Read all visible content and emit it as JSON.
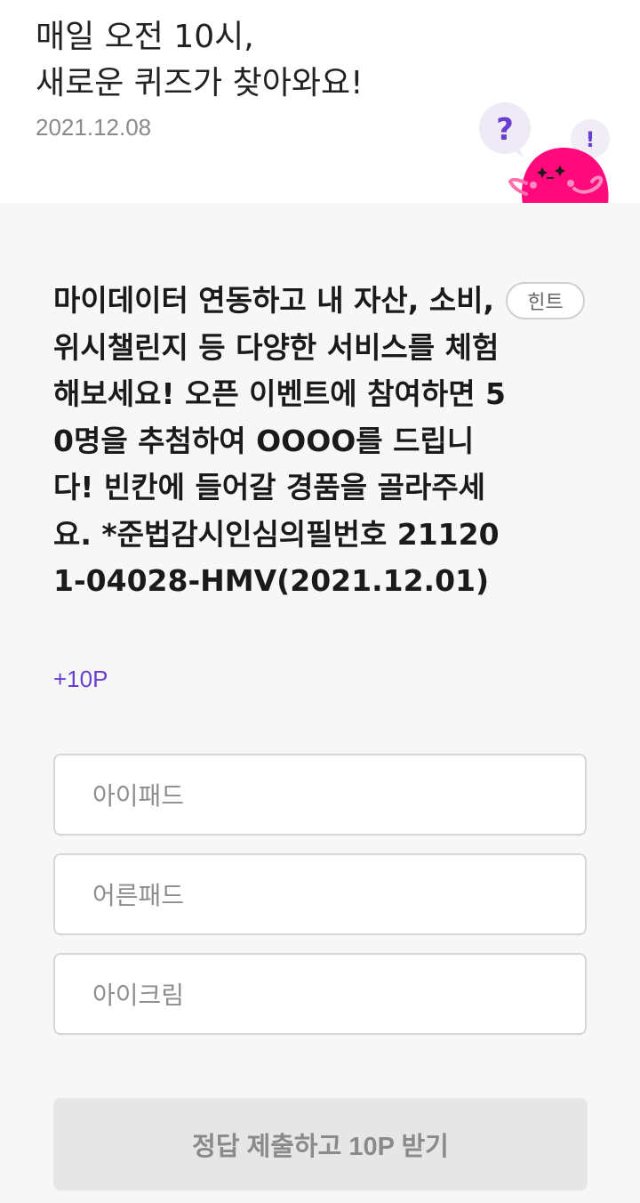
{
  "header": {
    "title": "매일 오전 10시,\n새로운 퀴즈가 찾아와요!",
    "date": "2021.12.08"
  },
  "mascot": {
    "bubble_left": "?",
    "bubble_right": "!",
    "accent_purple": "#6a3fd0",
    "body_color": "#ff0a7c"
  },
  "quiz": {
    "question": "마이데이터 연동하고 내 자산, 소비, 위시챌린지 등 다양한 서비스를 체험해보세요! 오픈 이벤트에 참여하면 50명을 추첨하여 OOOO를 드립니다! 빈칸에 들어갈 경품을 골라주세요. *준법감시인심의필번호 211201-04028-HMV(2021.12.01)",
    "hint_label": "힌트",
    "reward": "+10P",
    "options": [
      {
        "label": "아이패드"
      },
      {
        "label": "어른패드"
      },
      {
        "label": "아이크림"
      }
    ],
    "submit_label": "정답 제출하고 10P 받기"
  }
}
